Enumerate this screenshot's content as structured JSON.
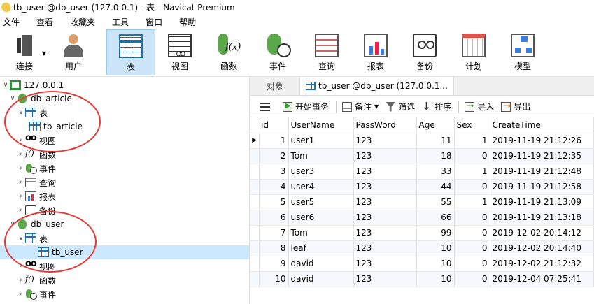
{
  "window": {
    "title": "tb_user @db_user (127.0.0.1) - 表 - Navicat Premium"
  },
  "menu": [
    "文件",
    "查看",
    "收藏夹",
    "工具",
    "窗口",
    "帮助"
  ],
  "toolbar": [
    {
      "label": "连接",
      "icon": "connection-icon"
    },
    {
      "label": "用户",
      "icon": "user-icon"
    },
    {
      "label": "表",
      "icon": "table-icon",
      "active": true
    },
    {
      "label": "视图",
      "icon": "view-icon"
    },
    {
      "label": "函数",
      "icon": "function-icon"
    },
    {
      "label": "事件",
      "icon": "event-icon"
    },
    {
      "label": "查询",
      "icon": "query-icon"
    },
    {
      "label": "报表",
      "icon": "report-icon"
    },
    {
      "label": "备份",
      "icon": "backup-icon"
    },
    {
      "label": "计划",
      "icon": "schedule-icon"
    },
    {
      "label": "模型",
      "icon": "model-icon"
    }
  ],
  "tree": [
    {
      "label": "127.0.0.1",
      "icon": "server-icon",
      "arrow": "∨"
    },
    {
      "label": "db_article",
      "icon": "database-icon",
      "arrow": "∨"
    },
    {
      "label": "表",
      "icon": "table-icon",
      "arrow": "∨"
    },
    {
      "label": "tb_article",
      "icon": "table-icon",
      "arrow": ""
    },
    {
      "label": "视图",
      "icon": "view-icon",
      "arrow": "›"
    },
    {
      "label": "函数",
      "icon": "function-icon",
      "arrow": "›"
    },
    {
      "label": "事件",
      "icon": "event-icon",
      "arrow": "›"
    },
    {
      "label": "查询",
      "icon": "query-icon",
      "arrow": "›"
    },
    {
      "label": "报表",
      "icon": "report-icon",
      "arrow": "›"
    },
    {
      "label": "备份",
      "icon": "backup-icon",
      "arrow": "›"
    },
    {
      "label": "db_user",
      "icon": "database-icon",
      "arrow": "∨"
    },
    {
      "label": "表",
      "icon": "table-icon",
      "arrow": "∨"
    },
    {
      "label": "tb_user",
      "icon": "table-icon",
      "arrow": "",
      "selected": true
    },
    {
      "label": "视图",
      "icon": "view-icon",
      "arrow": "›"
    },
    {
      "label": "函数",
      "icon": "function-icon",
      "arrow": "›"
    },
    {
      "label": "事件",
      "icon": "event-icon",
      "arrow": "›"
    }
  ],
  "tabs": {
    "objects": "对象",
    "active": "tb_user @db_user (127.0.0.1..."
  },
  "datatools": {
    "begin_transaction": "开始事务",
    "memo": "备注",
    "filter": "筛选",
    "sort": "排序",
    "import": "导入",
    "export": "导出"
  },
  "grid": {
    "columns": [
      "id",
      "UserName",
      "PassWord",
      "Age",
      "Sex",
      "CreateTime"
    ],
    "rows": [
      [
        "1",
        "user1",
        "123",
        "11",
        "1",
        "2019-11-19 21:12:26"
      ],
      [
        "2",
        "Tom",
        "123",
        "18",
        "0",
        "2019-11-19 21:12:35"
      ],
      [
        "3",
        "user3",
        "123",
        "33",
        "1",
        "2019-11-19 21:12:48"
      ],
      [
        "4",
        "user4",
        "123",
        "44",
        "0",
        "2019-11-19 21:12:58"
      ],
      [
        "5",
        "user5",
        "123",
        "55",
        "1",
        "2019-11-19 21:13:09"
      ],
      [
        "6",
        "user6",
        "123",
        "66",
        "0",
        "2019-11-19 21:13:18"
      ],
      [
        "7",
        "Tom",
        "123",
        "99",
        "0",
        "2019-12-02 20:14:12"
      ],
      [
        "8",
        "leaf",
        "123",
        "10",
        "0",
        "2019-12-02 20:14:40"
      ],
      [
        "9",
        "david",
        "123",
        "10",
        "0",
        "2019-12-02 21:12:32"
      ],
      [
        "10",
        "david",
        "123",
        "10",
        "0",
        "2019-12-04 07:25:41"
      ]
    ]
  }
}
